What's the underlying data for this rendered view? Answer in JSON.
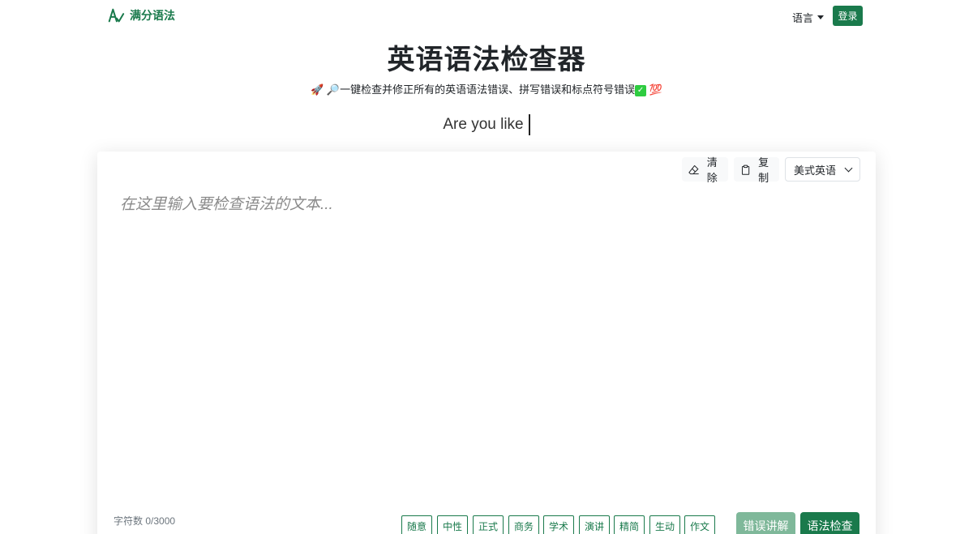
{
  "nav": {
    "logo_text": "满分语法",
    "language_label": "语言",
    "login_label": "登录"
  },
  "hero": {
    "title": "英语语法检查器",
    "subtitle_text": "一键检查并修正所有的英语语法错误、拼写错误和标点符号错误",
    "typing_text": "Are you like"
  },
  "editor": {
    "clear_label": "清除",
    "copy_label": "复制",
    "dialect_selected": "美式英语",
    "placeholder": "在这里输入要检查语法的文本...",
    "char_count": "字符数 0/3000",
    "tones": [
      "随意",
      "中性",
      "正式",
      "商务",
      "学术",
      "演讲",
      "精简",
      "生动",
      "作文"
    ],
    "explain_label": "错误讲解",
    "check_label": "语法检查"
  },
  "colors": {
    "brand": "#1a7a4c",
    "brand_light": "#7fb89a"
  }
}
